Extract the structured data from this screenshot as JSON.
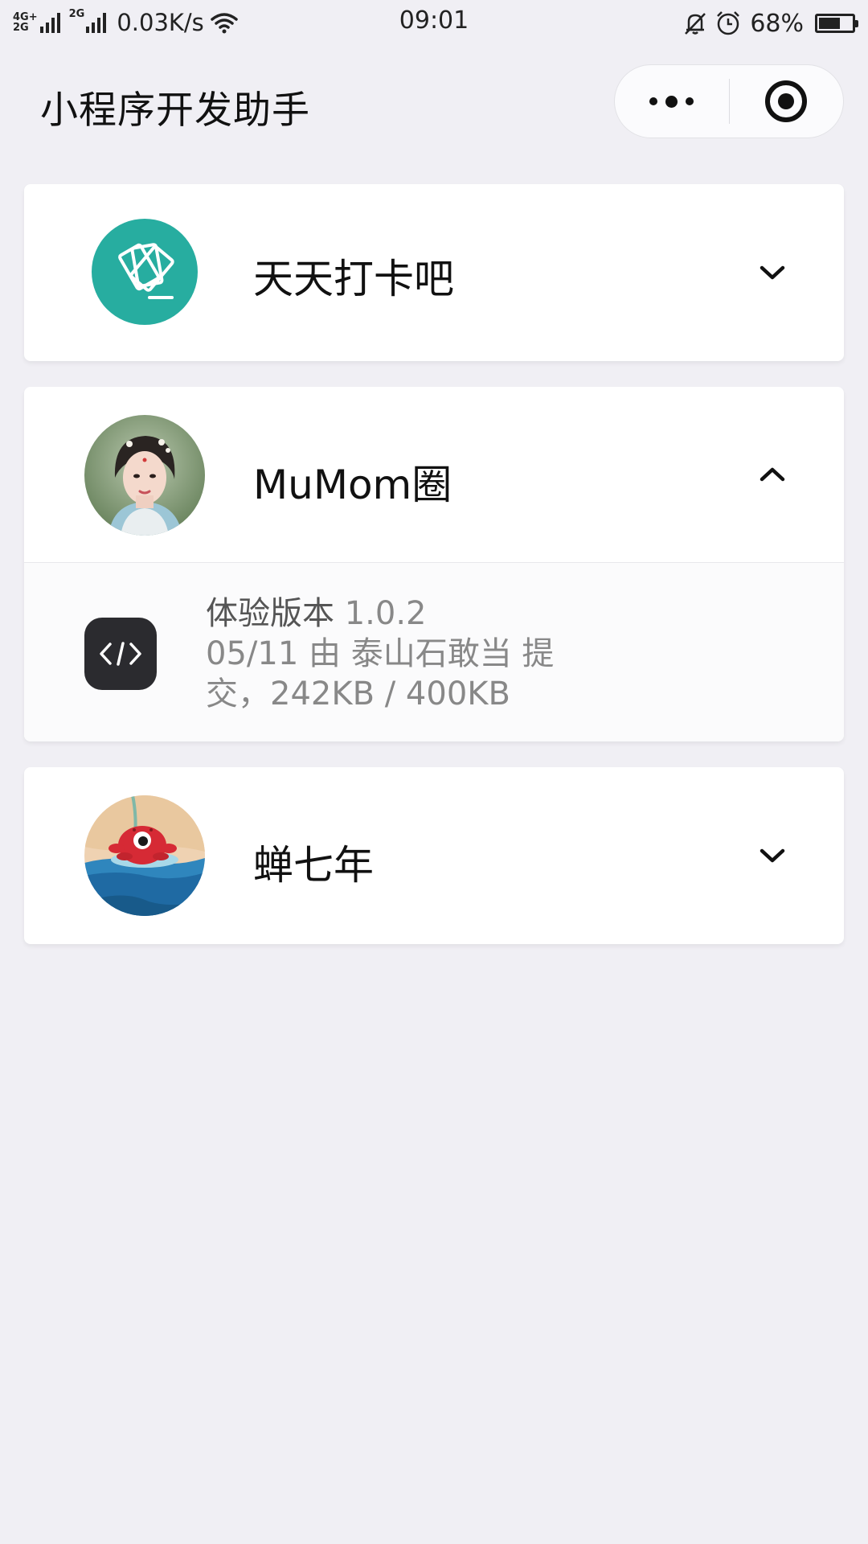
{
  "status_bar": {
    "network_primary": "4G+",
    "network_secondary": "2G",
    "network_2g_b": "2G",
    "speed": "0.03K/s",
    "time": "09:01",
    "battery_percent": 68,
    "battery_text": "68%",
    "icons": [
      "signal-icon",
      "wifi-icon",
      "mute-bell-icon",
      "alarm-icon",
      "battery-icon"
    ]
  },
  "nav": {
    "title": "小程序开发助手",
    "more_icon": "more-dots-icon",
    "close_icon": "target-icon"
  },
  "apps": [
    {
      "name": "天天打卡吧",
      "expanded": false,
      "avatar_icon": "tickets-icon",
      "avatar_color": "#27ada0",
      "chevron_icon": "chevron-down-icon"
    },
    {
      "name": "MuMom圈",
      "expanded": true,
      "avatar_icon": "portrait-avatar",
      "chevron_icon": "chevron-up-icon",
      "versions": [
        {
          "icon": "code-icon",
          "label": "体验版本",
          "version": "1.0.2",
          "line2": "05/11 由 泰山石敢当 提",
          "line3": "交，242KB / 400KB"
        }
      ]
    },
    {
      "name": "蝉七年",
      "expanded": false,
      "avatar_icon": "red-creature-avatar",
      "chevron_icon": "chevron-down-icon"
    }
  ],
  "colors": {
    "background": "#f0eff4",
    "card": "#ffffff",
    "accent_teal": "#27ada0",
    "secondary_text": "#888888"
  }
}
